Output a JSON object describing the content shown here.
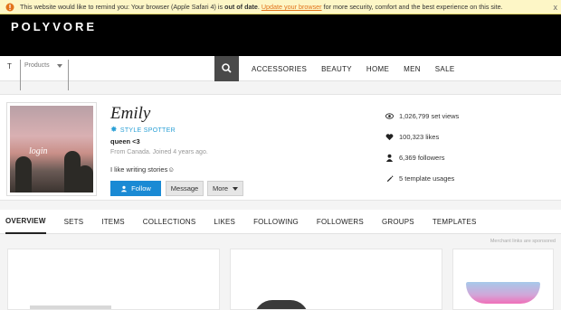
{
  "notice": {
    "text_before": "This website would like to remind you: Your browser (Apple Safari 4) is ",
    "bold": "out of date",
    "text_mid": ". ",
    "link": "Update your browser",
    "text_after": " for more security, comfort and the best experience on this site.",
    "close": "x"
  },
  "header": {
    "logo": "POLYVORE"
  },
  "search": {
    "value": "T",
    "category": "Products"
  },
  "nav": [
    "ACCESSORIES",
    "BEAUTY",
    "HOME",
    "MEN",
    "SALE"
  ],
  "profile": {
    "avatar_text": "login",
    "name": "Emily",
    "badge": "STYLE SPOTTER",
    "tagline": "queen <3",
    "meta": "From Canada. Joined 4 years ago.",
    "bio": "I like writing stories☺",
    "buttons": {
      "follow": "Follow",
      "message": "Message",
      "more": "More"
    }
  },
  "stats": [
    {
      "icon": "eye-icon",
      "text": "1,026,799 set views"
    },
    {
      "icon": "heart-icon",
      "text": "100,323 likes"
    },
    {
      "icon": "person-icon",
      "text": "6,369 followers"
    },
    {
      "icon": "pen-icon",
      "text": "5 template usages"
    }
  ],
  "tabs": [
    "OVERVIEW",
    "SETS",
    "ITEMS",
    "COLLECTIONS",
    "LIKES",
    "FOLLOWING",
    "FOLLOWERS",
    "GROUPS",
    "TEMPLATES"
  ],
  "sponsor": "Merchant links are sponsored",
  "colors": {
    "accent": "#1a8ad4",
    "badge": "#2ba0d6",
    "header": "#000000"
  }
}
